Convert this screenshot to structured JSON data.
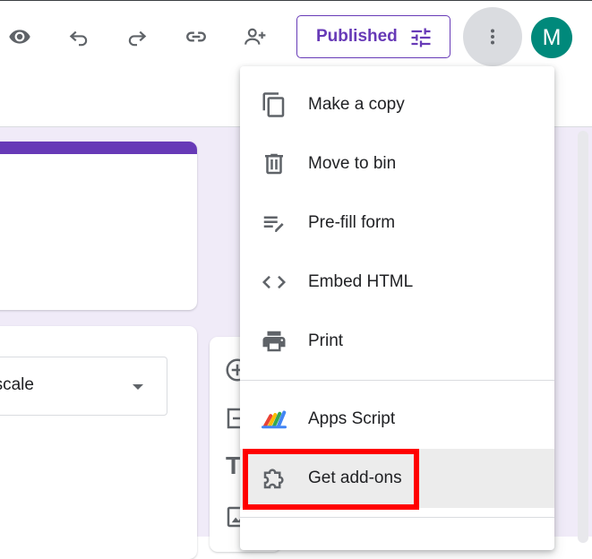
{
  "toolbar": {
    "published_label": "Published",
    "avatar_initial": "M"
  },
  "question": {
    "type_value": "r scale"
  },
  "menu": {
    "items": [
      {
        "label": "Make a copy",
        "icon": "copy-icon"
      },
      {
        "label": "Move to bin",
        "icon": "trash-icon"
      },
      {
        "label": "Pre-fill form",
        "icon": "prefill-icon"
      },
      {
        "label": "Embed HTML",
        "icon": "code-icon"
      },
      {
        "label": "Print",
        "icon": "printer-icon"
      },
      {
        "label": "Apps Script",
        "icon": "apps-script-icon"
      },
      {
        "label": "Get add-ons",
        "icon": "puzzle-icon",
        "highlighted": true
      }
    ]
  },
  "colors": {
    "accent": "#673ab7",
    "avatar": "#00897b",
    "canvas_bg": "#f0ebf8",
    "annotation": "#ff0000"
  }
}
